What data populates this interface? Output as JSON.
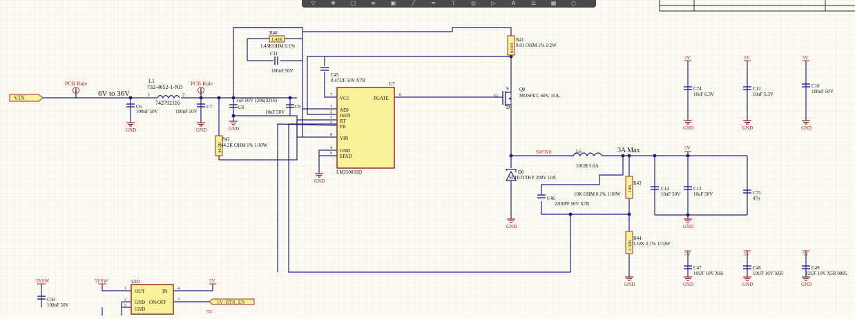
{
  "theme": {
    "wire": "#1e1e8c",
    "part": "#9a2b2b",
    "power": "#b02020",
    "ground": "#9a2020",
    "body_fill": "#fcf29a",
    "grid": "#ececdc",
    "rule": "#cc2020",
    "bg": "#fbfbf4"
  },
  "toolbar": {
    "icons": [
      "filter-icon",
      "move-icon",
      "select-icon",
      "align-icon",
      "place-part-icon",
      "wire-icon",
      "bus-icon",
      "power-icon",
      "net-label-icon",
      "port-icon",
      "text-icon",
      "parameter-icon",
      "ic-icon",
      "shapes-icon"
    ]
  },
  "ports": {
    "vin": "VIN",
    "rtr_en": "5V_RTR_EN"
  },
  "rules": {
    "a": "PCB Rule",
    "b": "PCB Rule"
  },
  "nets": {
    "vin_range": "6V to 36V",
    "sw": "SW5V0",
    "max": "3A Max"
  },
  "ic_u7": {
    "ref": "U7",
    "part": "LM25085SD",
    "pins": {
      "vcc": "VCC",
      "adj": "ADJ",
      "isen": "ISEN",
      "rt": "RT",
      "fb": "FB",
      "vin": "VIN",
      "gnd": "GND",
      "epad": "EPAD",
      "pgate": "PGATE"
    },
    "nums": {
      "p7": "7",
      "p1": "1",
      "p2": "2",
      "p3": "3",
      "p5": "5",
      "p8": "8",
      "p4": "4",
      "p9": "9",
      "p6": "6"
    }
  },
  "ic_u10": {
    "ref": "U10",
    "pins": {
      "out": "OUT",
      "in": "IN",
      "gnd": "GND",
      "onoff": "ON/OFF",
      "gnd2": "GND"
    },
    "nums": {
      "p1": "1",
      "p4": "4",
      "p2": "2",
      "p3": "3",
      "p5": "5"
    }
  },
  "l1": {
    "ref": "L1",
    "part": "732-4652-1-ND",
    "value": "742792116",
    "p1": "1",
    "p2": "2"
  },
  "l6": {
    "ref": "L6",
    "value": "10UH 5.6A"
  },
  "q8": {
    "ref": "Q8",
    "value": "MOSFET, 60V, 15A,",
    "g": "G",
    "s": "S",
    "d": "D"
  },
  "d6": {
    "ref": "D6",
    "value": "SCHOTTKY 200V 10A"
  },
  "resistors": {
    "r40": {
      "ref": "R40",
      "label": "1.43K",
      "value": "1.43KOHM 0.1%"
    },
    "r41": {
      "ref": "R41",
      "label": "0.010",
      "value": "0.01 OHM 1% 1/2W"
    },
    "r42": {
      "ref": "R42",
      "label": "44.2K",
      "value": "44.2K OHM 1% 1/10W"
    },
    "r43": {
      "ref": "R43",
      "label": "10K",
      "value": "10K OHM 0.1% 1/10W"
    },
    "r44": {
      "ref": "R44",
      "label": "3.32K",
      "value": "3.32K 0.1% 1/10W"
    }
  },
  "capacitors": {
    "c6": {
      "ref": "C6",
      "value": "100nF 50V"
    },
    "c7": {
      "ref": "C7",
      "value": "100nF 50V"
    },
    "c8": {
      "ref": "C8",
      "value": "1uF 50V 1206(3216)"
    },
    "c9": {
      "ref": "C9",
      "value": "10uF 50V"
    },
    "c11": {
      "ref": "C11",
      "value": "100nF 50V"
    },
    "c45": {
      "ref": "C45",
      "value": "0.47UF 50V X7R"
    },
    "c46": {
      "ref": "C46",
      "value": "2200PF 50V X7R"
    },
    "c14": {
      "ref": "C14",
      "value": "10uF 50V"
    },
    "c13": {
      "ref": "C13",
      "value": "10uF 50V"
    },
    "c75": {
      "ref": "C75",
      "value": "47p"
    },
    "c74": {
      "ref": "C74",
      "value": "10uF 6.3V"
    },
    "c12": {
      "ref": "C12",
      "value": "10uF 6.3V"
    },
    "c10": {
      "ref": "C10",
      "value": "100nF 50V"
    },
    "c47": {
      "ref": "C47",
      "value": "10UF 10V X6S"
    },
    "c48": {
      "ref": "C48",
      "value": "10UF 10V X6S"
    },
    "c49": {
      "ref": "C49",
      "value": "22UF 10V X5R 0805"
    },
    "c50": {
      "ref": "C50",
      "value": "100nF 50V"
    }
  },
  "power": {
    "p5v": "5V",
    "p5vsw": "5VSW"
  },
  "gnd": "GND"
}
